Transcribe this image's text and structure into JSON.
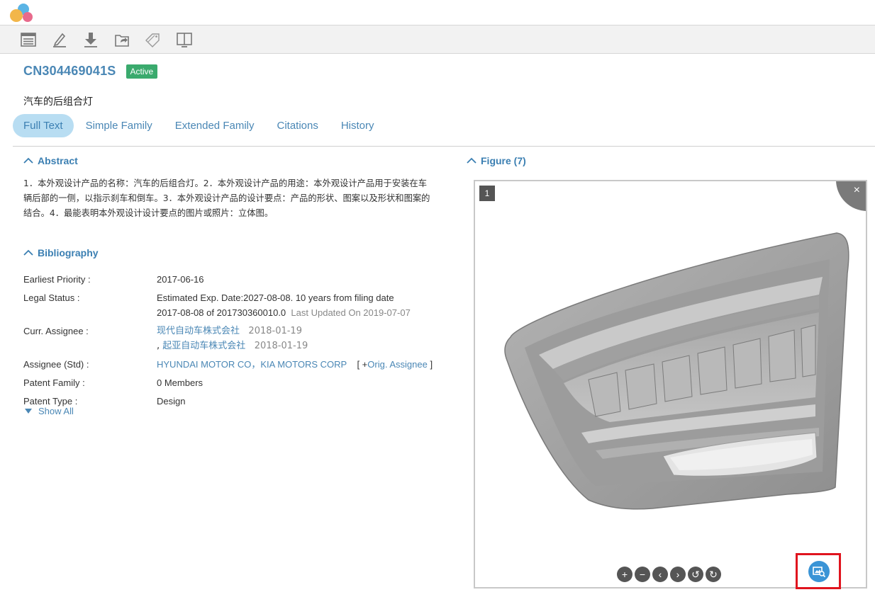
{
  "patent": {
    "number": "CN304469041S",
    "status": "Active",
    "title": "汽车的后组合灯"
  },
  "toolbar": {
    "icons": [
      "list-icon",
      "edit-icon",
      "download-icon",
      "export-icon",
      "tag-icon",
      "reader-icon"
    ]
  },
  "tabs": [
    {
      "label": "Full Text",
      "active": true
    },
    {
      "label": "Simple Family",
      "active": false
    },
    {
      "label": "Extended Family",
      "active": false
    },
    {
      "label": "Citations",
      "active": false
    },
    {
      "label": "History",
      "active": false
    }
  ],
  "abstract": {
    "heading": "Abstract",
    "text": "1．本外观设计产品的名称：汽车的后组合灯。2．本外观设计产品的用途：本外观设计产品用于安装在车辆后部的一侧，以指示刹车和倒车。3．本外观设计产品的设计要点：产品的形状、图案以及形状和图案的结合。4．最能表明本外观设计设计要点的图片或照片：立体图。"
  },
  "bibliography": {
    "heading": "Bibliography",
    "earliest_priority_label": "Earliest Priority :",
    "earliest_priority": "2017-06-16",
    "legal_status_label": "Legal Status :",
    "legal_status_line1": "Estimated Exp. Date:2027-08-08. 10 years from filing date",
    "legal_status_line2": "2017-08-08 of 201730360010.0",
    "legal_status_updated": "Last Updated On 2019-07-07",
    "curr_assignee_label": "Curr. Assignee :",
    "curr_assignee_1": "现代自动车株式会社",
    "curr_assignee_1_date": "2018-01-19",
    "curr_assignee_2_prefix": ",",
    "curr_assignee_2": "起亚自动车株式会社",
    "curr_assignee_2_date": "2018-01-19",
    "assignee_std_label": "Assignee (Std) :",
    "assignee_std": "HYUNDAI MOTOR CO，KIA MOTORS CORP",
    "orig_assignee_open": "[ +",
    "orig_assignee_link": "Orig. Assignee",
    "orig_assignee_close": "]",
    "patent_family_label": "Patent Family :",
    "patent_family": "0 Members",
    "patent_type_label": "Patent Type :",
    "patent_type": "Design",
    "show_all": "Show All"
  },
  "figure": {
    "heading": "Figure",
    "count": "(7)",
    "index": "1",
    "close": "×",
    "controls": [
      "+",
      "−",
      "‹",
      "›",
      "↺",
      "↻"
    ]
  }
}
